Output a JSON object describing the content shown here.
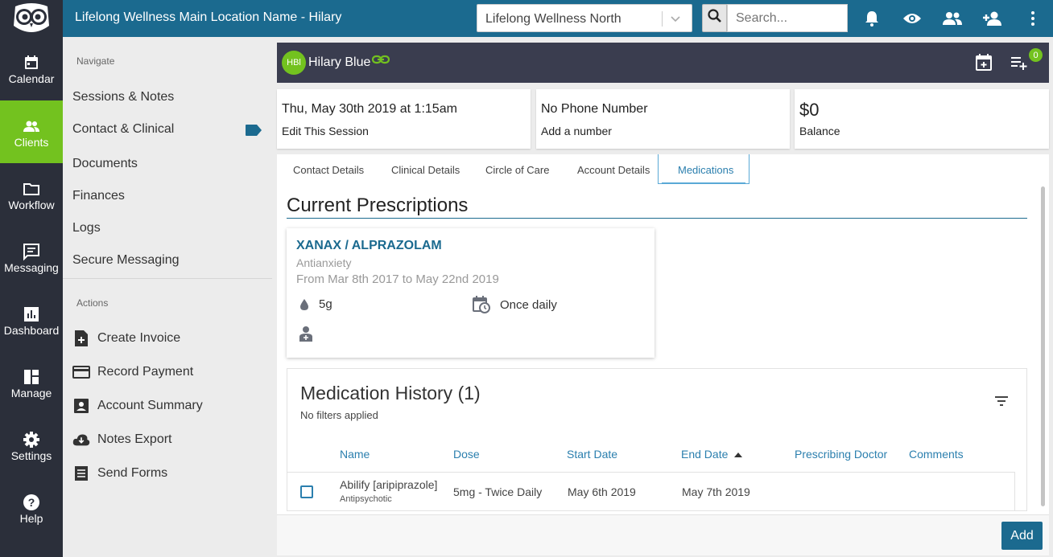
{
  "header": {
    "app_title": "Lifelong Wellness Main Location Name - Hilary",
    "location_select": "Lifelong Wellness North",
    "search_placeholder": "Search..."
  },
  "rail": [
    {
      "label": "Calendar",
      "icon": "calendar-icon"
    },
    {
      "label": "Clients",
      "icon": "clients-icon",
      "active": true
    },
    {
      "label": "Workflow",
      "icon": "folder-icon"
    },
    {
      "label": "Messaging",
      "icon": "message-icon"
    },
    {
      "label": "Dashboard",
      "icon": "chart-icon"
    },
    {
      "label": "Manage",
      "icon": "manage-icon"
    },
    {
      "label": "Settings",
      "icon": "gear-icon"
    },
    {
      "label": "Help",
      "icon": "help-icon"
    }
  ],
  "subnav": {
    "navigate_heading": "Navigate",
    "links": [
      "Sessions & Notes",
      "Contact & Clinical",
      "Documents",
      "Finances",
      "Logs",
      "Secure Messaging"
    ],
    "actions_heading": "Actions",
    "actions": [
      "Create Invoice",
      "Record Payment",
      "Account Summary",
      "Notes Export",
      "Send Forms"
    ]
  },
  "client": {
    "initials": "HBl",
    "name": "Hilary Blue",
    "badge_count": "0"
  },
  "cards": {
    "session_date": "Thu, May 30th 2019 at 1:15am",
    "session_action": "Edit This Session",
    "phone": "No Phone Number",
    "phone_action": "Add a number",
    "balance": "$0",
    "balance_label": "Balance"
  },
  "tabs": [
    "Contact Details",
    "Clinical Details",
    "Circle of Care",
    "Account Details",
    "Medications"
  ],
  "active_tab": "Medications",
  "prescriptions": {
    "title": "Current Prescriptions",
    "name": "XANAX / ALPRAZOLAM",
    "class": "Antianxiety",
    "range": "From Mar 8th 2017 to May 22nd 2019",
    "dose": "5g",
    "frequency": "Once daily"
  },
  "history": {
    "title": "Medication History (1)",
    "filters": "No filters applied",
    "columns": [
      "Name",
      "Dose",
      "Start Date",
      "End Date",
      "Prescribing Doctor",
      "Comments"
    ],
    "rows": [
      {
        "name": "Abilify [aripiprazole]",
        "class": "Antipsychotic",
        "dose": "5mg - Twice Daily",
        "start": "May 6th 2019",
        "end": "May 7th 2019",
        "doctor": "",
        "comments": ""
      }
    ]
  },
  "footer": {
    "add_label": "Add"
  },
  "colors": {
    "brand": "#1b6a8f",
    "accent": "#73c21f",
    "dark": "#2b2f3a"
  }
}
